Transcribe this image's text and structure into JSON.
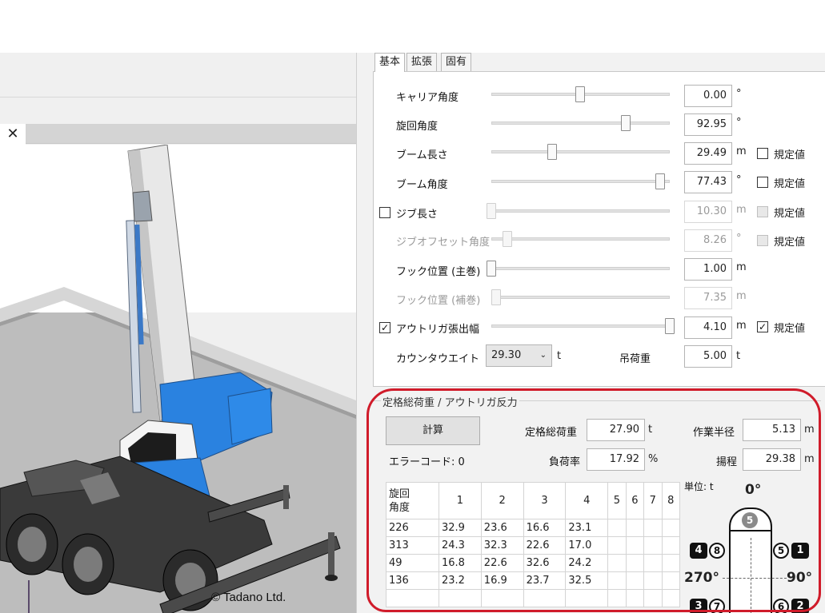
{
  "tabs": [
    {
      "label": "基本"
    },
    {
      "label": "拡張"
    },
    {
      "label": "固有"
    }
  ],
  "params": {
    "carrier_angle": {
      "label": "キャリア角度",
      "value": "0.00",
      "unit": "°"
    },
    "swing_angle": {
      "label": "旋回角度",
      "value": "92.95",
      "unit": "°"
    },
    "boom_length": {
      "label": "ブーム長さ",
      "value": "29.49",
      "unit": "m",
      "check_label": "規定値"
    },
    "boom_angle": {
      "label": "ブーム角度",
      "value": "77.43",
      "unit": "°",
      "check_label": "規定値"
    },
    "jib_length": {
      "label": "ジブ長さ",
      "value": "10.30",
      "unit": "m",
      "check_label": "規定値"
    },
    "jib_offset": {
      "label": "ジブオフセット角度",
      "value": "8.26",
      "unit": "°",
      "check_label": "規定値"
    },
    "hook_main": {
      "label": "フック位置 (主巻)",
      "value": "1.00",
      "unit": "m"
    },
    "hook_aux": {
      "label": "フック位置 (補巻)",
      "value": "7.35",
      "unit": "m"
    },
    "outrigger": {
      "label": "アウトリガ張出幅",
      "value": "4.10",
      "unit": "m",
      "check_label": "規定値"
    },
    "counterweight": {
      "label": "カウンタウエイト",
      "value": "29.30",
      "unit": "t"
    },
    "load": {
      "label": "吊荷重",
      "value": "5.00",
      "unit": "t"
    }
  },
  "result": {
    "group_title": "定格総荷重 / アウトリガ反力",
    "calc_button": "計算",
    "error_code": "エラーコード: 0",
    "rated_load_label": "定格総荷重",
    "rated_load_value": "27.90",
    "rated_load_unit": "t",
    "load_rate_label": "負荷率",
    "load_rate_value": "17.92",
    "load_rate_unit": "%",
    "radius_label": "作業半径",
    "radius_value": "5.13",
    "radius_unit": "m",
    "lift_label": "揚程",
    "lift_value": "29.38",
    "lift_unit": "m",
    "unit_note": "単位: t"
  },
  "table": {
    "header_first": "旋回\n角度",
    "columns": [
      "1",
      "2",
      "3",
      "4",
      "5",
      "6",
      "7",
      "8"
    ],
    "rows": [
      [
        "226",
        "32.9",
        "23.6",
        "16.6",
        "23.1",
        "",
        "",
        "",
        ""
      ],
      [
        "313",
        "24.3",
        "32.3",
        "22.6",
        "17.0",
        "",
        "",
        "",
        ""
      ],
      [
        "49",
        "16.8",
        "22.6",
        "32.6",
        "24.2",
        "",
        "",
        "",
        ""
      ],
      [
        "136",
        "23.2",
        "16.9",
        "23.7",
        "32.5",
        "",
        "",
        "",
        ""
      ],
      [
        "",
        "",
        "",
        "",
        "",
        "",
        "",
        "",
        ""
      ]
    ]
  },
  "diagram": {
    "angle_top": "0°",
    "angle_left": "270°",
    "angle_right": "90°",
    "badges": [
      "5",
      "4",
      "8",
      "5",
      "1",
      "3",
      "7",
      "6",
      "2"
    ]
  },
  "copyright": "© Tadano Ltd."
}
